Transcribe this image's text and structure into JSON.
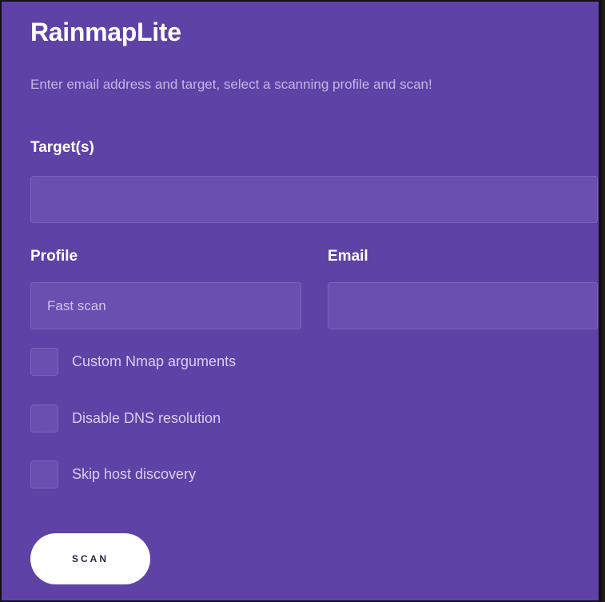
{
  "app": {
    "title": "RainmapLite",
    "subtitle": "Enter email address and target, select a scanning profile and scan!"
  },
  "form": {
    "targets_label": "Target(s)",
    "targets_value": "",
    "profile_label": "Profile",
    "profile_value": "Fast scan",
    "email_label": "Email",
    "email_value": ""
  },
  "options": [
    {
      "label": "Custom Nmap arguments",
      "checked": false
    },
    {
      "label": "Disable DNS resolution",
      "checked": false
    },
    {
      "label": "Skip host discovery",
      "checked": false
    }
  ],
  "actions": {
    "scan_label": "SCAN"
  },
  "colors": {
    "background": "#5e42a6",
    "field": "#6a4fb0",
    "button": "#ffffff"
  }
}
